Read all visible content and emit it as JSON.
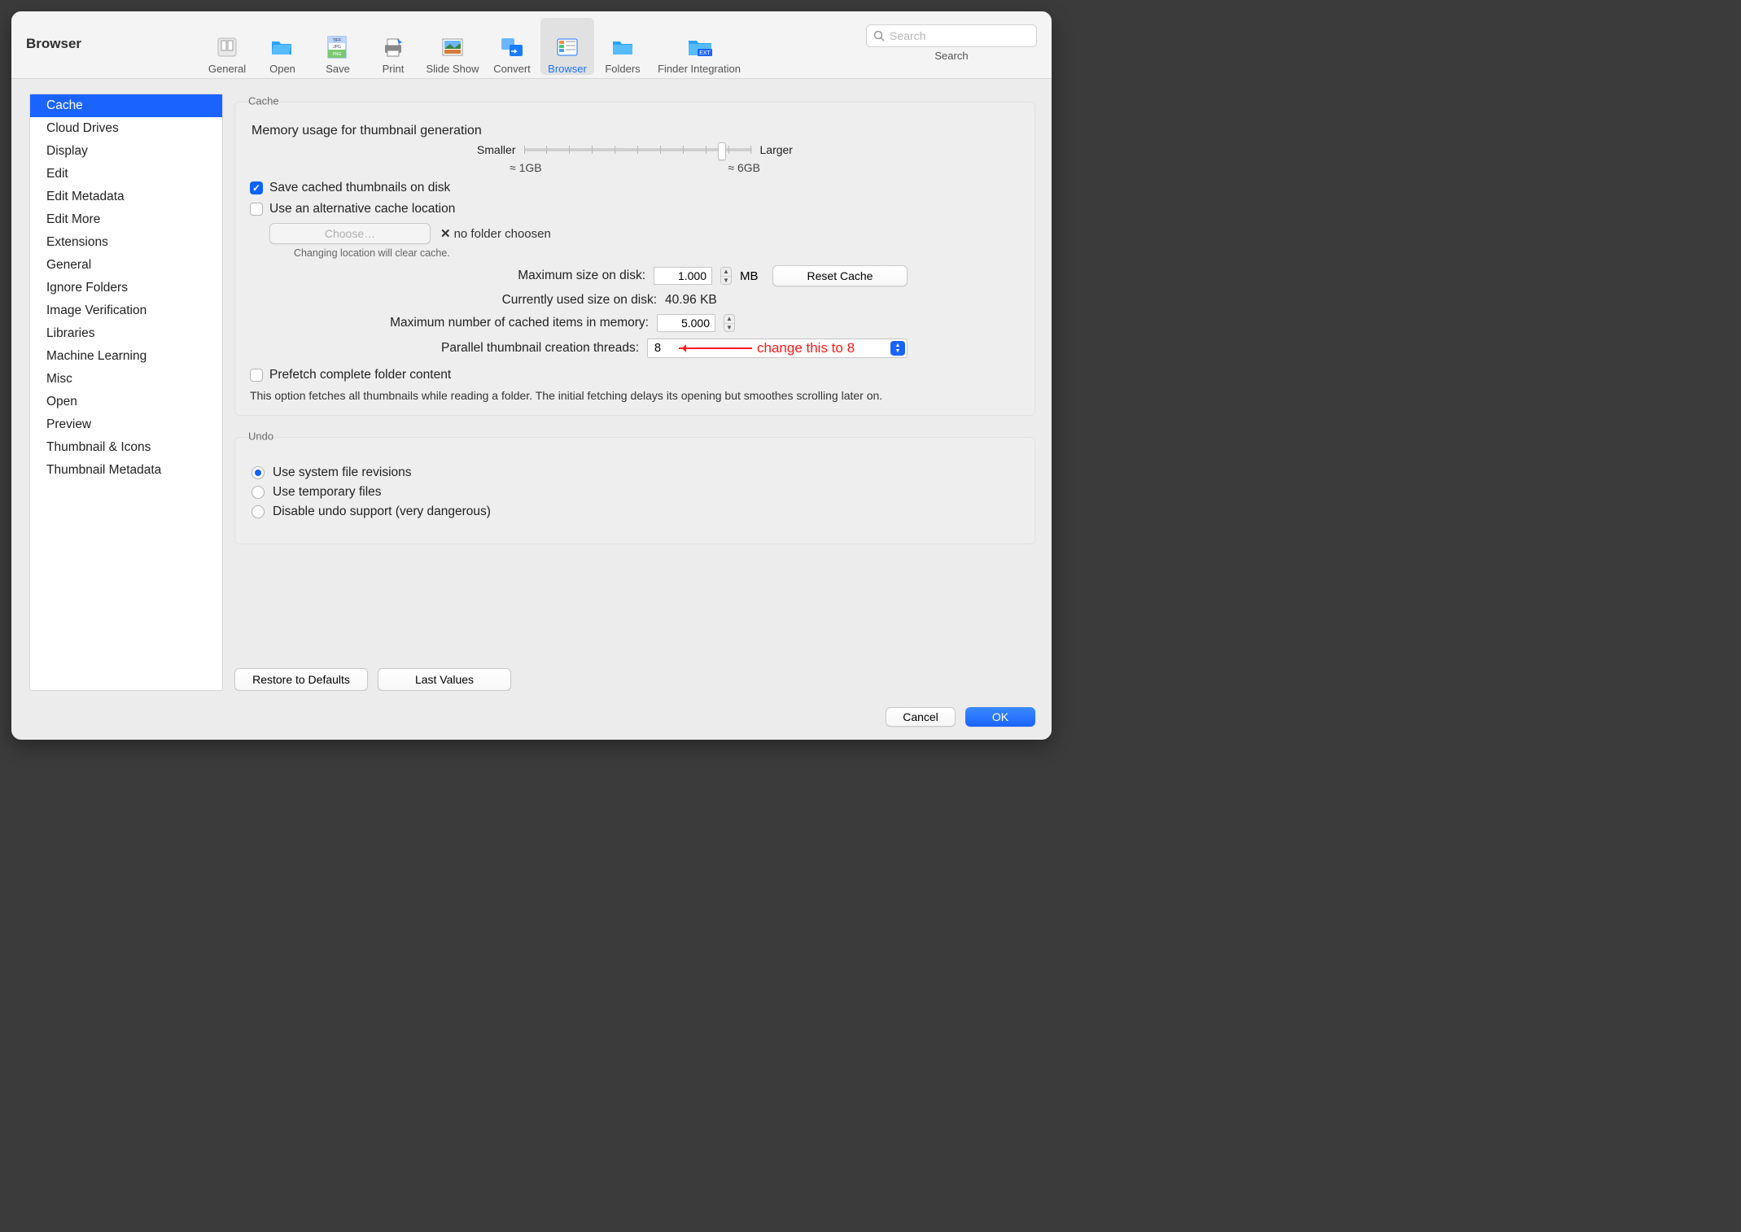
{
  "window": {
    "title": "Browser"
  },
  "toolbar": {
    "items": [
      {
        "label": "General"
      },
      {
        "label": "Open"
      },
      {
        "label": "Save"
      },
      {
        "label": "Print"
      },
      {
        "label": "Slide Show"
      },
      {
        "label": "Convert"
      },
      {
        "label": "Browser"
      },
      {
        "label": "Folders"
      },
      {
        "label": "Finder Integration"
      }
    ],
    "active_index": 6,
    "search_placeholder": "Search",
    "search_label": "Search"
  },
  "sidebar": {
    "items": [
      "Cache",
      "Cloud Drives",
      "Display",
      "Edit",
      "Edit Metadata",
      "Edit More",
      "Extensions",
      "General",
      "Ignore Folders",
      "Image Verification",
      "Libraries",
      "Machine Learning",
      "Misc",
      "Open",
      "Preview",
      "Thumbnail & Icons",
      "Thumbnail Metadata"
    ],
    "selected_index": 0
  },
  "cache": {
    "group_title": "Cache",
    "mem_heading": "Memory usage for thumbnail generation",
    "smaller": "Smaller",
    "larger": "Larger",
    "scale_lo": "≈ 1GB",
    "scale_hi": "≈ 6GB",
    "save_disk_label": "Save cached thumbnails on disk",
    "save_disk_checked": true,
    "alt_loc_label": "Use an alternative cache location",
    "alt_loc_checked": false,
    "choose_btn": "Choose…",
    "no_folder": "no folder choosen",
    "changing_note": "Changing location will clear cache.",
    "max_size_label": "Maximum size on disk:",
    "max_size_value": "1.000",
    "max_size_unit": "MB",
    "reset_btn": "Reset Cache",
    "used_label": "Currently used size on disk:",
    "used_value": "40.96 KB",
    "max_items_label": "Maximum number of cached items in memory:",
    "max_items_value": "5.000",
    "threads_label": "Parallel thumbnail creation threads:",
    "threads_value": "8",
    "annotation": "change this to 8",
    "prefetch_label": "Prefetch complete folder content",
    "prefetch_checked": false,
    "prefetch_desc": "This option fetches all thumbnails while reading a folder. The initial fetching delays its opening but smoothes scrolling later on."
  },
  "undo": {
    "group_title": "Undo",
    "opt1": "Use system file revisions",
    "opt2": "Use temporary files",
    "opt3": "Disable undo support (very dangerous)",
    "selected": 0
  },
  "bottom": {
    "restore": "Restore to Defaults",
    "last": "Last Values"
  },
  "footer": {
    "cancel": "Cancel",
    "ok": "OK"
  }
}
